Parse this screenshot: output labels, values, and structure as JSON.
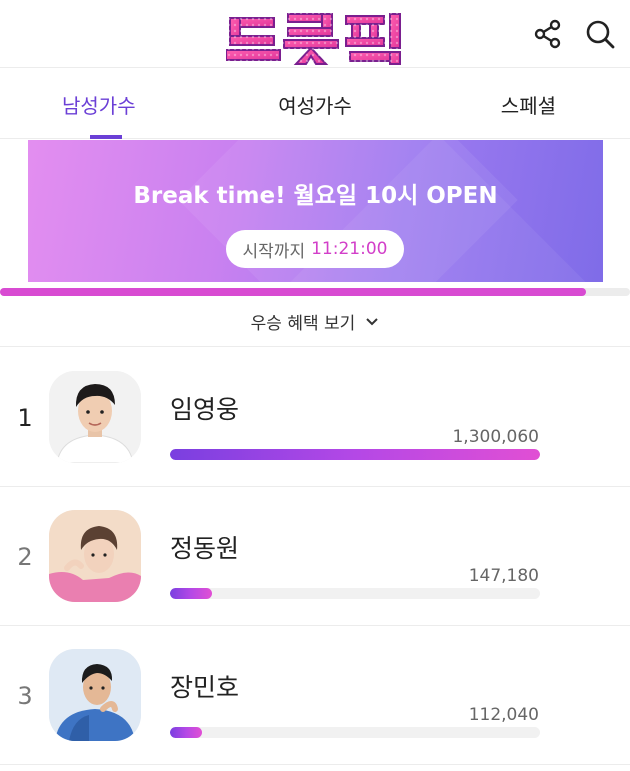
{
  "header": {
    "logo_text": "트롯픽"
  },
  "tabs": [
    {
      "label": "남성가수",
      "active": true
    },
    {
      "label": "여성가수",
      "active": false
    },
    {
      "label": "스페셜",
      "active": false
    }
  ],
  "banner": {
    "title": "Break time! 월요일 10시 OPEN",
    "countdown_label": "시작까지",
    "countdown_time": "11:21:00"
  },
  "timer_progress": 0.93,
  "benefit": {
    "label": "우승 혜택 보기"
  },
  "rankings": [
    {
      "rank": "1",
      "name": "임영웅",
      "votes": "1,300,060",
      "ratio": 1.0
    },
    {
      "rank": "2",
      "name": "정동원",
      "votes": "147,180",
      "ratio": 0.113
    },
    {
      "rank": "3",
      "name": "장민호",
      "votes": "112,040",
      "ratio": 0.086
    }
  ],
  "colors": {
    "accent": "#6b3fd6",
    "countdown": "#d23fc9",
    "progress": "#d84bd2"
  }
}
